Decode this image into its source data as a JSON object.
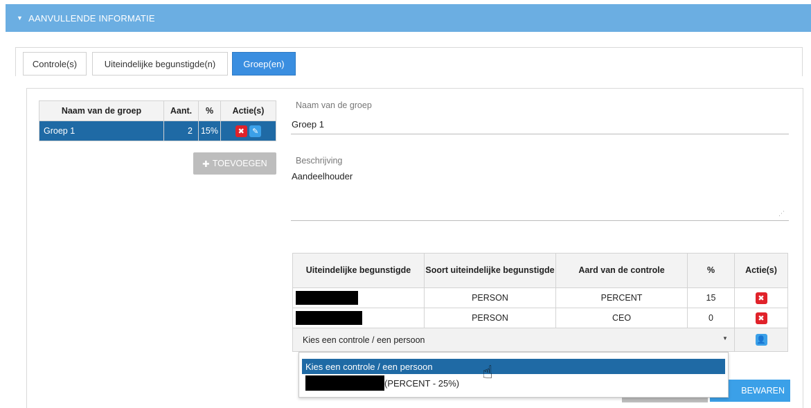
{
  "section": {
    "title": "AANVULLENDE INFORMATIE",
    "caret": "▼"
  },
  "tabs": [
    {
      "label": "Controle(s)"
    },
    {
      "label": "Uiteindelijke begunstigde(n)"
    },
    {
      "label": "Groep(en)",
      "active": true
    }
  ],
  "group_table": {
    "headers": [
      "Naam van de groep",
      "Aant.",
      "%",
      "Actie(s)"
    ],
    "rows": [
      {
        "name": "Groep 1",
        "count": "2",
        "percent": "15%"
      }
    ]
  },
  "add_button": {
    "icon": "✚",
    "label": "TOEVOEGEN"
  },
  "form": {
    "name_label": "Naam van de groep",
    "name_value": "Groep 1",
    "desc_label": "Beschrijving",
    "desc_value": "Aandeelhouder"
  },
  "beneficiary_table": {
    "headers": [
      "Uiteindelijke begunstigde",
      "Soort uiteindelijke begunstigde",
      "Aard van de controle",
      "%",
      "Actie(s)"
    ],
    "rows": [
      {
        "type": "PERSON",
        "control": "PERCENT",
        "percent": "15"
      },
      {
        "type": "PERSON",
        "control": "CEO",
        "percent": "0"
      }
    ],
    "select_placeholder": "Kies een controle / een persoon"
  },
  "dropdown": {
    "option1": "Kies een controle / een persoon",
    "option2_suffix": "(PERCENT - 25%)"
  },
  "save_button": {
    "label": "BEWAREN"
  },
  "colors": {
    "header_bg": "#6baee2",
    "selected_row": "#1f6aa5",
    "delete": "#e0222a",
    "accent": "#3ba0e8"
  }
}
